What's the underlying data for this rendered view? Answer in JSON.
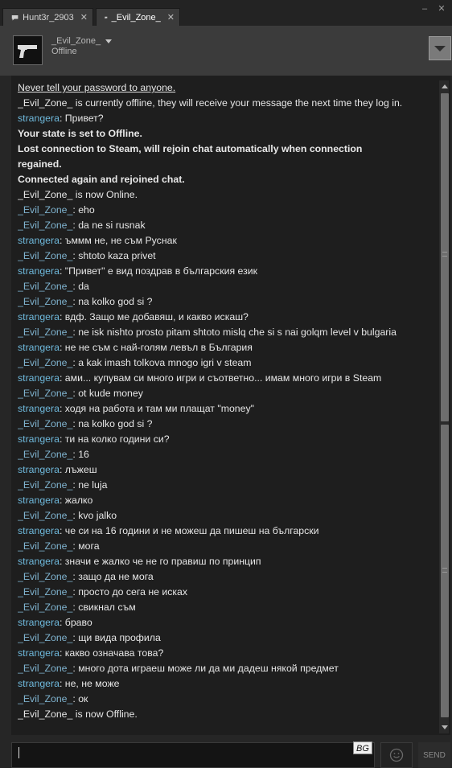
{
  "tabs": [
    {
      "label": "Hunt3r_2903",
      "close": "✕",
      "active": false
    },
    {
      "label": "_Evil_Zone_",
      "close": "✕",
      "active": true
    }
  ],
  "window": {
    "minimize": "–",
    "close": "✕"
  },
  "friend": {
    "name": "_Evil_Zone_",
    "status": "Offline"
  },
  "colors": {
    "sender_self": "#6eb8db",
    "sender_other": "#7fb3cf",
    "text": "#e6e6e6"
  },
  "messages": [
    {
      "type": "notice",
      "text": "Never tell your password to anyone."
    },
    {
      "type": "system",
      "text": "_Evil_Zone_ is currently offline, they will receive your message the next time they log in."
    },
    {
      "type": "msg",
      "sender": "strangera",
      "text": ": Привет?"
    },
    {
      "type": "bold",
      "text": "Your state is set to Offline."
    },
    {
      "type": "bold",
      "text": "Lost connection to Steam, will rejoin chat automatically when connection"
    },
    {
      "type": "bold",
      "text": "regained."
    },
    {
      "type": "bold",
      "text": "Connected again and rejoined chat."
    },
    {
      "type": "system",
      "text": "_Evil_Zone_ is now Online."
    },
    {
      "type": "msg",
      "sender": "_Evil_Zone_",
      "text": ": eho"
    },
    {
      "type": "msg",
      "sender": "_Evil_Zone_",
      "text": ": da ne si rusnak"
    },
    {
      "type": "msg",
      "sender": "strangera",
      "text": ": ъммм не, не съм Руснак"
    },
    {
      "type": "msg",
      "sender": "_Evil_Zone_",
      "text": ": shtoto kaza privet"
    },
    {
      "type": "msg",
      "sender": "strangera",
      "text": ": \"Привет\" е вид поздрав в българския език"
    },
    {
      "type": "msg",
      "sender": "_Evil_Zone_",
      "text": ": da"
    },
    {
      "type": "msg",
      "sender": "_Evil_Zone_",
      "text": ": na kolko god si ?"
    },
    {
      "type": "msg",
      "sender": "strangera",
      "text": ": вдф. Защо ме добавяш, и какво искаш?"
    },
    {
      "type": "msg",
      "sender": "_Evil_Zone_",
      "text": ": ne isk nishto prosto pitam shtoto mislq che si s nai golqm level v bulgaria"
    },
    {
      "type": "msg",
      "sender": "strangera",
      "text": ": не не съм с най-голям левъл в България"
    },
    {
      "type": "msg",
      "sender": "_Evil_Zone_",
      "text": ": a kak imash tolkova mnogo igri v steam"
    },
    {
      "type": "msg",
      "sender": "strangera",
      "text": ": ами... купувам си много игри и съответно... имам много игри в Steam"
    },
    {
      "type": "msg",
      "sender": "_Evil_Zone_",
      "text": ": ot kude money"
    },
    {
      "type": "msg",
      "sender": "strangera",
      "text": ": ходя на работа и там ми плащат \"money\""
    },
    {
      "type": "msg",
      "sender": "_Evil_Zone_",
      "text": ": na kolko god si ?"
    },
    {
      "type": "msg",
      "sender": "strangera",
      "text": ": ти на колко години си?"
    },
    {
      "type": "msg",
      "sender": "_Evil_Zone_",
      "text": ": 16"
    },
    {
      "type": "msg",
      "sender": "strangera",
      "text": ": лъжеш"
    },
    {
      "type": "msg",
      "sender": "_Evil_Zone_",
      "text": ": ne luja"
    },
    {
      "type": "msg",
      "sender": "strangera",
      "text": ": жалко"
    },
    {
      "type": "msg",
      "sender": "_Evil_Zone_",
      "text": ": kvo jalko"
    },
    {
      "type": "msg",
      "sender": "strangera",
      "text": ": че си на 16 години и не можеш да пишеш на български"
    },
    {
      "type": "msg",
      "sender": "_Evil_Zone_",
      "text": ": мога"
    },
    {
      "type": "msg",
      "sender": "strangera",
      "text": ": значи е жалко че не го правиш по принцип"
    },
    {
      "type": "msg",
      "sender": "_Evil_Zone_",
      "text": ": защо да не мога"
    },
    {
      "type": "msg",
      "sender": "_Evil_Zone_",
      "text": ": просто до сега не исках"
    },
    {
      "type": "msg",
      "sender": "_Evil_Zone_",
      "text": ": свикнал съм"
    },
    {
      "type": "msg",
      "sender": "strangera",
      "text": ": браво"
    },
    {
      "type": "msg",
      "sender": "_Evil_Zone_",
      "text": ": щи вида профила"
    },
    {
      "type": "msg",
      "sender": "strangera",
      "text": ": какво означава това?"
    },
    {
      "type": "msg",
      "sender": "_Evil_Zone_",
      "text": ": много дота играеш може ли да ми дадеш някой предмет"
    },
    {
      "type": "msg",
      "sender": "strangera",
      "text": ": не, не може"
    },
    {
      "type": "msg",
      "sender": "_Evil_Zone_",
      "text": ": ок"
    },
    {
      "type": "system",
      "text": "_Evil_Zone_ is now Offline."
    }
  ],
  "input": {
    "value": "",
    "lang_badge": "BG",
    "send_label": "SEND"
  }
}
